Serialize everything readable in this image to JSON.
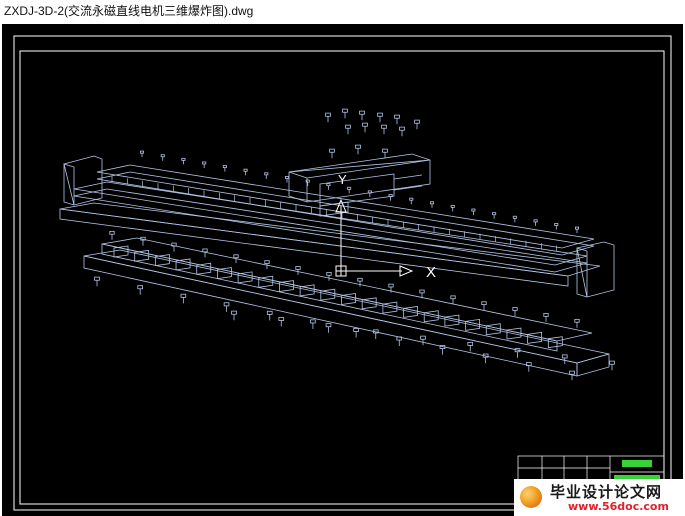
{
  "window": {
    "title": "ZXDJ-3D-2(交流永磁直线电机三维爆炸图).dwg"
  },
  "drawing": {
    "background": "#000000",
    "linework_color": "#b4c6e6",
    "frame_color": "#ffffff",
    "ucs_x_label": "X",
    "ucs_y_label": "Y",
    "title_block_color": "#36d236"
  },
  "watermark": {
    "title": "毕业设计论文网",
    "url": "www.56doc.com",
    "url_color": "#e0202a"
  }
}
